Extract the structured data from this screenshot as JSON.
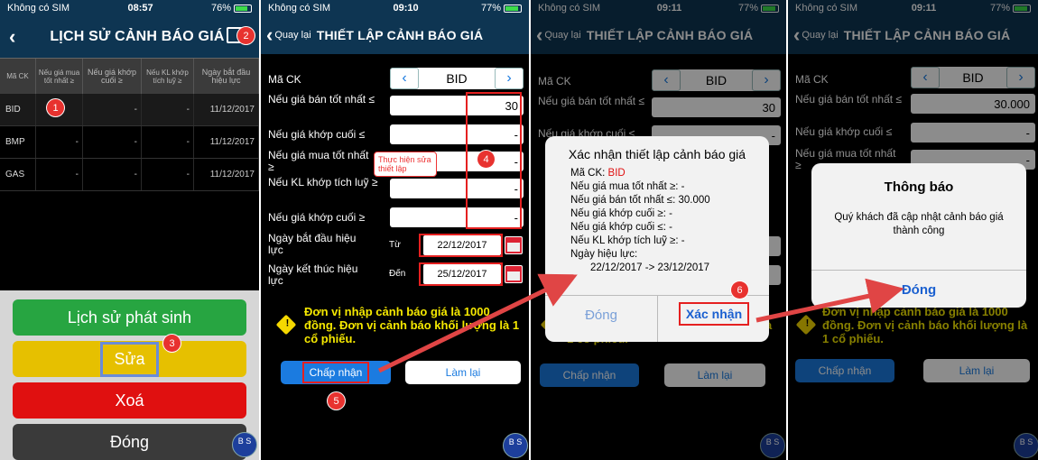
{
  "colors": {
    "navbar": "#0e3552",
    "green": "#27a541",
    "yellow": "#e6c000",
    "red": "#e01010",
    "accent": "#1b7be0"
  },
  "screen1": {
    "status": {
      "carrier": "Không có SIM",
      "time": "08:57",
      "battery": "76%"
    },
    "title": "LỊCH SỬ CẢNH BÁO GIÁ",
    "headers": [
      "Mã CK",
      "Nếu giá mua tốt nhất ≥",
      "Nếu giá khớp cuối ≥",
      "Nếu KL khớp tích luỹ ≥",
      "Ngày bắt đầu hiệu lực"
    ],
    "rows": [
      {
        "code": "BID",
        "c1": "-",
        "c2": "-",
        "c3": "-",
        "date": "11/12/2017"
      },
      {
        "code": "BMP",
        "c1": "-",
        "c2": "-",
        "c3": "-",
        "date": "11/12/2017"
      },
      {
        "code": "GAS",
        "c1": "-",
        "c2": "-",
        "c3": "-",
        "date": "11/12/2017"
      }
    ],
    "btn_history": "Lịch sử phát sinh",
    "btn_edit": "Sửa",
    "btn_delete": "Xoá",
    "btn_close": "Đóng",
    "badges": [
      "1",
      "2",
      "3"
    ]
  },
  "form": {
    "back": "Quay lại",
    "title": "THIẾT LẬP CẢNH BÁO GIÁ",
    "label_code": "Mã CK",
    "code": "BID",
    "label_best_sell": "Nếu giá bán tốt nhất ≤",
    "label_last_le": "Nếu giá khớp cuối ≤",
    "label_best_buy": "Nếu giá mua tốt nhất ≥",
    "label_vol": "Nếu KL khớp tích luỹ ≥",
    "label_last_ge": "Nếu giá khớp cuối ≥",
    "label_start": "Ngày bắt đầu hiệu lực",
    "label_end": "Ngày kết thúc hiệu lực",
    "from": "Từ",
    "to": "Đến",
    "start_date": "22/12/2017",
    "end_date": "25/12/2017",
    "dash": "-",
    "warning": "Đơn vị nhập cảnh báo giá là 1000 đồng. Đơn vị cảnh báo khối lượng là 1 cổ phiếu.",
    "btn_accept": "Chấp nhận",
    "btn_reset": "Làm lại"
  },
  "screen2": {
    "status": {
      "carrier": "Không có SIM",
      "time": "09:10",
      "battery": "77%"
    },
    "best_sell": "30",
    "tooltip": "Thực hiện sửa thiết lập",
    "badges": [
      "4",
      "5"
    ]
  },
  "screen3": {
    "status": {
      "carrier": "Không có SIM",
      "time": "09:11",
      "battery": "77%"
    },
    "best_sell": "30",
    "dialog_title": "Xác nhận thiết lập cảnh báo giá",
    "line_code_label": "Mã CK: ",
    "line_code": "BID",
    "lines": [
      "Nếu giá mua tốt nhất ≥: -",
      "Nếu giá bán tốt nhất ≤: 30.000",
      "Nếu giá khớp cuối ≥: -",
      "Nếu giá khớp cuối ≤: -",
      "Nếu KL khớp tích luỹ ≥: -",
      "Ngày hiệu lực:",
      "22/12/2017 -> 23/12/2017"
    ],
    "btn_close": "Đóng",
    "btn_confirm": "Xác nhận",
    "badge": "6"
  },
  "screen4": {
    "status": {
      "carrier": "Không có SIM",
      "time": "09:11",
      "battery": "77%"
    },
    "best_sell": "30.000",
    "dialog_title": "Thông báo",
    "dialog_msg": "Quý khách đã cập nhật cảnh báo giá thành công",
    "btn_close": "Đóng"
  },
  "bs": "B S"
}
